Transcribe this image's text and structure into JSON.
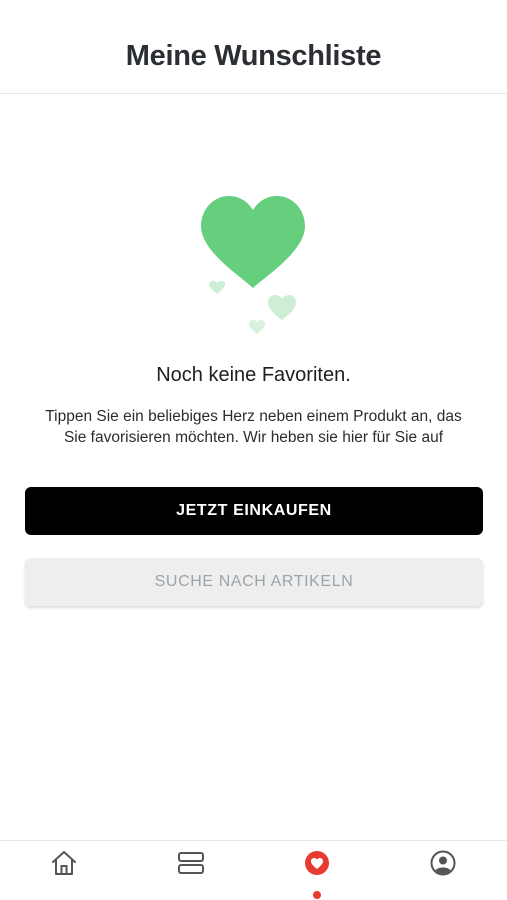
{
  "header": {
    "title": "Meine Wunschliste"
  },
  "empty_state": {
    "title": "Noch keine Favoriten.",
    "description_line1": "Tippen Sie ein beliebiges Herz neben einem Produkt an, das",
    "description_line2": "Sie favorisieren möchten. Wir heben sie hier für Sie auf"
  },
  "actions": {
    "shop_label": "JETZT EINKAUFEN",
    "search_label": "SUCHE NACH ARTIKELN"
  },
  "tabbar": {
    "items": [
      {
        "icon": "home-icon",
        "active": false
      },
      {
        "icon": "catalog-icon",
        "active": false
      },
      {
        "icon": "heart-icon",
        "active": true
      },
      {
        "icon": "profile-icon",
        "active": false
      }
    ]
  },
  "colors": {
    "heart_green": "#66cf7e",
    "active_red": "#e63b2e",
    "primary_button": "#000000",
    "secondary_button": "#eeeeee"
  }
}
